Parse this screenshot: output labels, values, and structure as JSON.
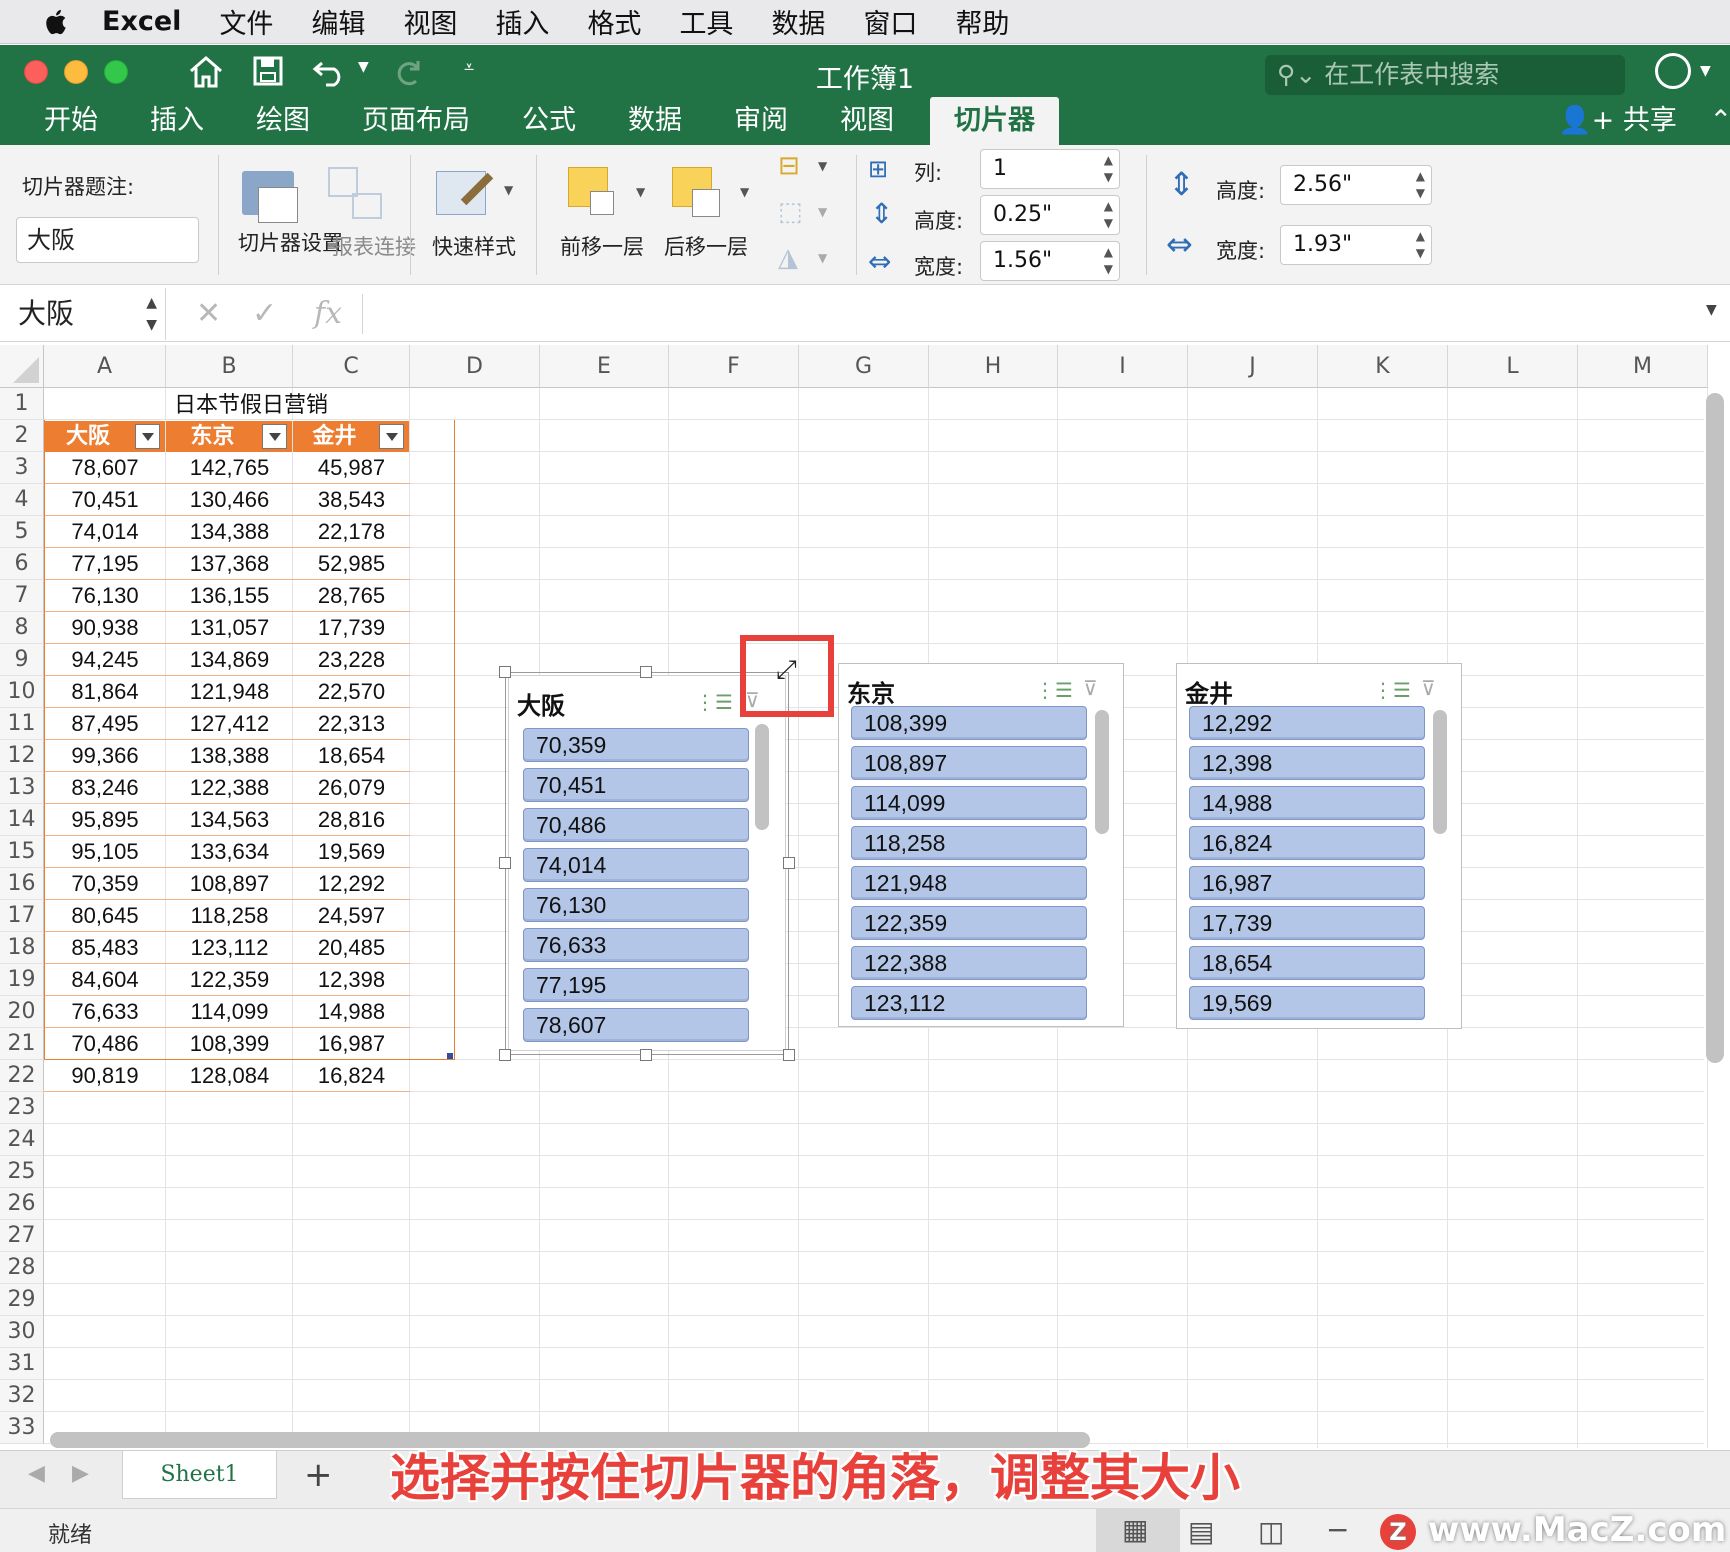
{
  "menubar": {
    "app": "Excel",
    "items": [
      "文件",
      "编辑",
      "视图",
      "插入",
      "格式",
      "工具",
      "数据",
      "窗口",
      "帮助"
    ]
  },
  "titlebar": {
    "title": "工作簿1",
    "search_placeholder": "在工作表中搜索"
  },
  "tabs": [
    {
      "label": "开始"
    },
    {
      "label": "插入"
    },
    {
      "label": "绘图"
    },
    {
      "label": "页面布局"
    },
    {
      "label": "公式"
    },
    {
      "label": "数据"
    },
    {
      "label": "审阅"
    },
    {
      "label": "视图"
    },
    {
      "label": "切片器"
    }
  ],
  "share_label": "共享",
  "ribbon": {
    "caption_label": "切片器题注:",
    "caption_value": "大阪",
    "slicer_settings": "切片器设置",
    "report_connections": "报表连接",
    "quick_styles": "快速样式",
    "bring_forward": "前移一层",
    "send_backward": "后移一层",
    "columns_label": "列:",
    "columns_value": "1",
    "button_height_label": "高度:",
    "button_height_value": "0.25\"",
    "button_width_label": "宽度:",
    "button_width_value": "1.56\"",
    "size_height_label": "高度:",
    "size_height_value": "2.56\"",
    "size_width_label": "宽度:",
    "size_width_value": "1.93\""
  },
  "formula_bar": {
    "name_box": "大阪",
    "fx": "fx"
  },
  "grid": {
    "columns": [
      "A",
      "B",
      "C",
      "D",
      "E",
      "F",
      "G",
      "H",
      "I",
      "J",
      "K",
      "L",
      "M"
    ],
    "rows": [
      "1",
      "2",
      "3",
      "4",
      "5",
      "6",
      "7",
      "8",
      "9",
      "10",
      "11",
      "12",
      "13",
      "14",
      "15",
      "16",
      "17",
      "18",
      "19",
      "20",
      "21",
      "22",
      "23",
      "24",
      "25",
      "26",
      "27",
      "28",
      "29",
      "30",
      "31",
      "32",
      "33"
    ],
    "table_title": "日本节假日营销",
    "headers": [
      "大阪",
      "东京",
      "金井"
    ],
    "data": [
      [
        "78,607",
        "142,765",
        "45,987"
      ],
      [
        "70,451",
        "130,466",
        "38,543"
      ],
      [
        "74,014",
        "134,388",
        "22,178"
      ],
      [
        "77,195",
        "137,368",
        "52,985"
      ],
      [
        "76,130",
        "136,155",
        "28,765"
      ],
      [
        "90,938",
        "131,057",
        "17,739"
      ],
      [
        "94,245",
        "134,869",
        "23,228"
      ],
      [
        "81,864",
        "121,948",
        "22,570"
      ],
      [
        "87,495",
        "127,412",
        "22,313"
      ],
      [
        "99,366",
        "138,388",
        "18,654"
      ],
      [
        "83,246",
        "122,388",
        "26,079"
      ],
      [
        "95,895",
        "134,563",
        "28,816"
      ],
      [
        "95,105",
        "133,634",
        "19,569"
      ],
      [
        "70,359",
        "108,897",
        "12,292"
      ],
      [
        "80,645",
        "118,258",
        "24,597"
      ],
      [
        "85,483",
        "123,112",
        "20,485"
      ],
      [
        "84,604",
        "122,359",
        "12,398"
      ],
      [
        "76,633",
        "114,099",
        "14,988"
      ],
      [
        "70,486",
        "108,399",
        "16,987"
      ],
      [
        "90,819",
        "128,084",
        "16,824"
      ]
    ]
  },
  "slicers": [
    {
      "title": "大阪",
      "items": [
        "70,359",
        "70,451",
        "70,486",
        "74,014",
        "76,130",
        "76,633",
        "77,195",
        "78,607"
      ]
    },
    {
      "title": "东京",
      "items": [
        "108,399",
        "108,897",
        "114,099",
        "118,258",
        "121,948",
        "122,359",
        "122,388",
        "123,112"
      ]
    },
    {
      "title": "金井",
      "items": [
        "12,292",
        "12,398",
        "14,988",
        "16,824",
        "16,987",
        "17,739",
        "18,654",
        "19,569"
      ]
    }
  ],
  "sheet_tab": "Sheet1",
  "status": {
    "ready": "就绪"
  },
  "overlay_caption": "选择并按住切片器的角落，调整其大小",
  "watermark": "www.MacZ.com",
  "colors": {
    "excel_green": "#217346",
    "header_orange": "#ed7d31",
    "slicer_item_blue": "#b4c6e7",
    "highlight_red": "#e8403a"
  }
}
